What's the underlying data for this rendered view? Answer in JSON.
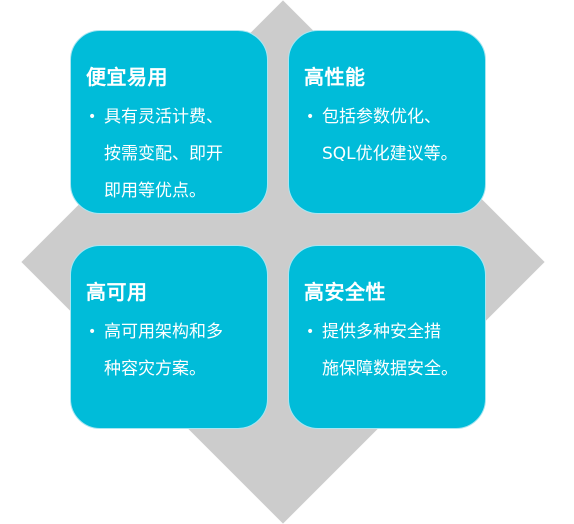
{
  "colors": {
    "card": "#00bcd9",
    "background_diamond": "#cccccc",
    "text": "#ffffff"
  },
  "cards": [
    {
      "title": "便宜易用",
      "lines": [
        "具有灵活计费、",
        "按需变配、即开",
        "即用等优点。"
      ]
    },
    {
      "title": "高性能",
      "lines": [
        "包括参数优化、",
        "SQL优化建议等。"
      ]
    },
    {
      "title": "高可用",
      "lines": [
        "高可用架构和多",
        "种容灾方案。"
      ]
    },
    {
      "title": "高安全性",
      "lines": [
        "提供多种安全措",
        "施保障数据安全。"
      ]
    }
  ]
}
